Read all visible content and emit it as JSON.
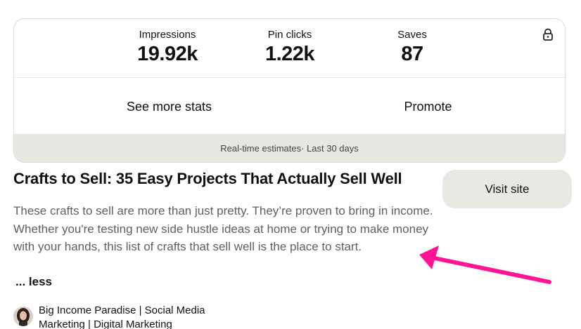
{
  "stats": {
    "metrics": [
      {
        "label": "Impressions",
        "value": "19.92k"
      },
      {
        "label": "Pin clicks",
        "value": "1.22k"
      },
      {
        "label": "Saves",
        "value": "87"
      }
    ],
    "actions": {
      "see_more": "See more stats",
      "promote": "Promote"
    },
    "estimates_note": "Real-time estimates· Last 30 days",
    "lock_icon": "lock-icon"
  },
  "pin": {
    "title": "Crafts to Sell: 35 Easy Projects That Actually Sell Well",
    "description": "These crafts to sell are more than just pretty. They’re proven to bring in income. Whether you're testing new side hustle ideas at home or trying to make money with your hands, this list of crafts that sell well is the place to start.",
    "less_label": "... less",
    "visit_site_label": "Visit site"
  },
  "creator": {
    "name": "Big Income Paradise | Social Media Marketing | Digital Marketing"
  },
  "colors": {
    "annotation_arrow": "#ff1493",
    "estimates_bg": "#e8e8e3",
    "button_bg": "#e9e9e4"
  }
}
